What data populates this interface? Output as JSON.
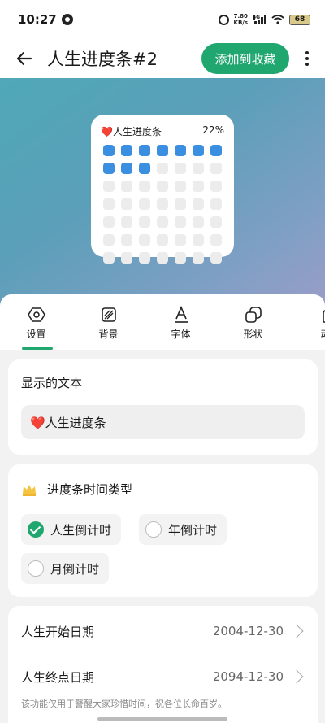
{
  "status": {
    "time": "10:27",
    "net_speed_value": "7.80",
    "net_speed_unit": "KB/s",
    "signal_tag": "5G",
    "battery": "68"
  },
  "app_bar": {
    "title": "人生进度条#2",
    "fav_label": "添加到收藏"
  },
  "widget": {
    "label": "❤️人生进度条",
    "percent": "22%",
    "filled_cells": 10,
    "total_cells": 49,
    "accent": "#3b8fe0"
  },
  "tabs": [
    {
      "label": "设置",
      "icon": "hexagon-settings-icon"
    },
    {
      "label": "背景",
      "icon": "background-icon"
    },
    {
      "label": "字体",
      "icon": "font-icon"
    },
    {
      "label": "形状",
      "icon": "shape-icon"
    },
    {
      "label": "动",
      "icon": "motion-icon"
    }
  ],
  "text_card": {
    "title": "显示的文本",
    "value": "❤️人生进度条"
  },
  "type_card": {
    "title": "进度条时间类型",
    "options": [
      {
        "label": "人生倒计时",
        "checked": true
      },
      {
        "label": "年倒计时",
        "checked": false
      },
      {
        "label": "月倒计时",
        "checked": false
      }
    ]
  },
  "date_card": {
    "start_label": "人生开始日期",
    "start_value": "2004-12-30",
    "end_label": "人生终点日期",
    "end_value": "2094-12-30",
    "note": "该功能仅用于警醒大家珍惜时间，祝各位长命百岁。"
  },
  "colors": {
    "accent": "#1fa76f"
  }
}
